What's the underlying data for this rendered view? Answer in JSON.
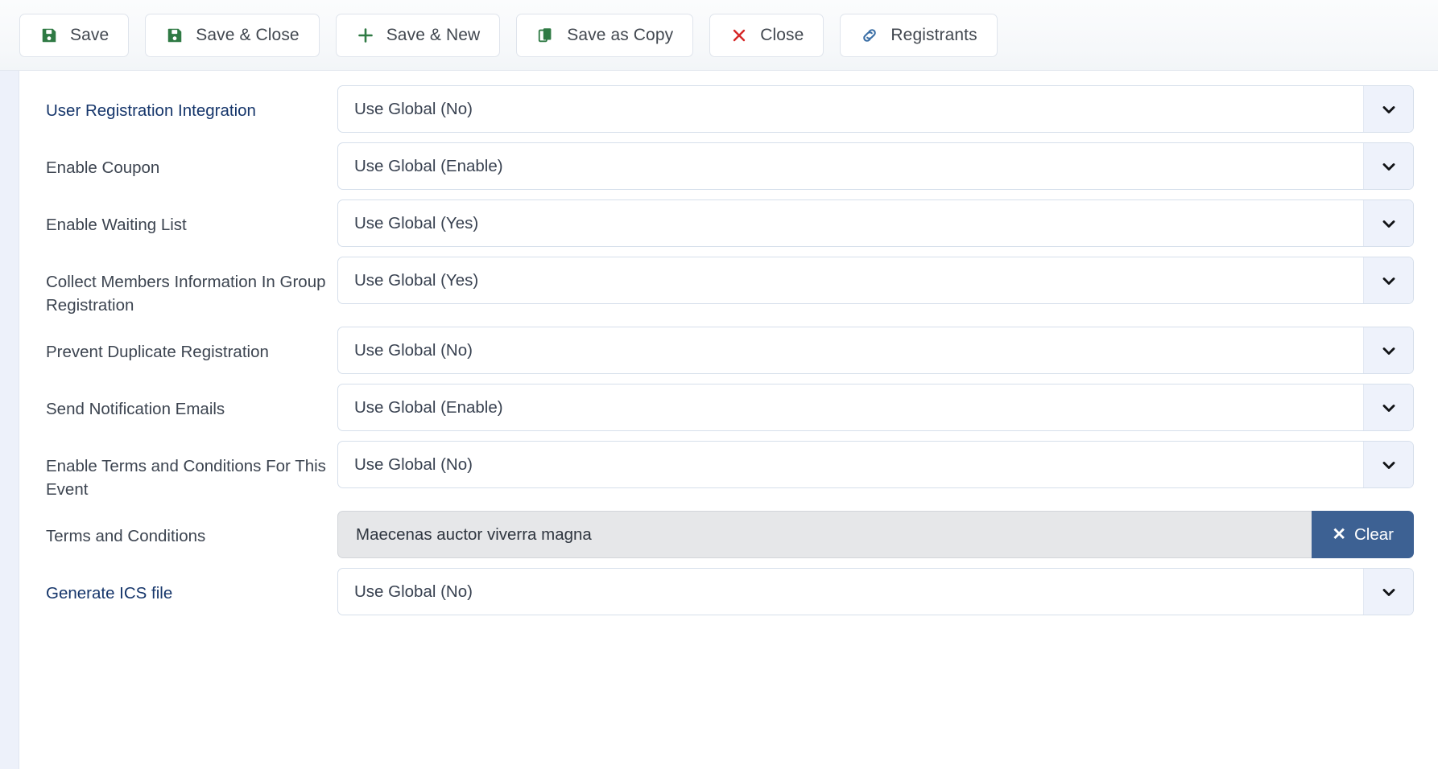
{
  "toolbar": {
    "buttons": [
      {
        "label": "Save",
        "icon": "floppy-disk-icon"
      },
      {
        "label": "Save & Close",
        "icon": "floppy-disk-icon"
      },
      {
        "label": "Save & New",
        "icon": "plus-icon"
      },
      {
        "label": "Save as Copy",
        "icon": "copy-icon"
      },
      {
        "label": "Close",
        "icon": "close-x-icon"
      },
      {
        "label": "Registrants",
        "icon": "link-chain-icon"
      }
    ]
  },
  "colors": {
    "save_icon_green": "#2f7a44",
    "close_icon_red": "#d62828",
    "link_icon_blue": "#3a6ea5",
    "clear_button_blue": "#3d6193",
    "label_link_navy": "#16366b",
    "left_rail": "#edf1fa"
  },
  "form": {
    "rows": [
      {
        "label": "User Registration Integration",
        "label_style": "link",
        "control": "select",
        "value": "Use Global (No)",
        "arrow_icon": "chevron-down-icon"
      },
      {
        "label": "Enable Coupon",
        "label_style": "normal",
        "control": "select",
        "value": "Use Global (Enable)",
        "arrow_icon": "chevron-down-icon"
      },
      {
        "label": "Enable Waiting List",
        "label_style": "normal",
        "control": "select",
        "value": "Use Global (Yes)",
        "arrow_icon": "chevron-down-icon"
      },
      {
        "label": "Collect Members Information In Group Registration",
        "label_style": "normal",
        "control": "select",
        "value": "Use Global (Yes)",
        "arrow_icon": "chevron-down-icon"
      },
      {
        "label": "Prevent Duplicate Registration",
        "label_style": "normal",
        "control": "select",
        "value": "Use Global (No)",
        "arrow_icon": "chevron-down-icon"
      },
      {
        "label": "Send Notification Emails",
        "label_style": "normal",
        "control": "select",
        "value": "Use Global (Enable)",
        "arrow_icon": "chevron-down-icon"
      },
      {
        "label": "Enable Terms and Conditions For This Event",
        "label_style": "normal",
        "control": "select",
        "value": "Use Global (No)",
        "arrow_icon": "chevron-down-icon"
      },
      {
        "label": "Terms and Conditions",
        "label_style": "normal",
        "control": "readonly_clear",
        "value": "Maecenas auctor viverra magna",
        "clear_label": "Clear",
        "clear_icon": "close-x-icon"
      },
      {
        "label": "Generate ICS file",
        "label_style": "link",
        "control": "select",
        "value": "Use Global (No)",
        "arrow_icon": "chevron-down-icon"
      }
    ]
  }
}
